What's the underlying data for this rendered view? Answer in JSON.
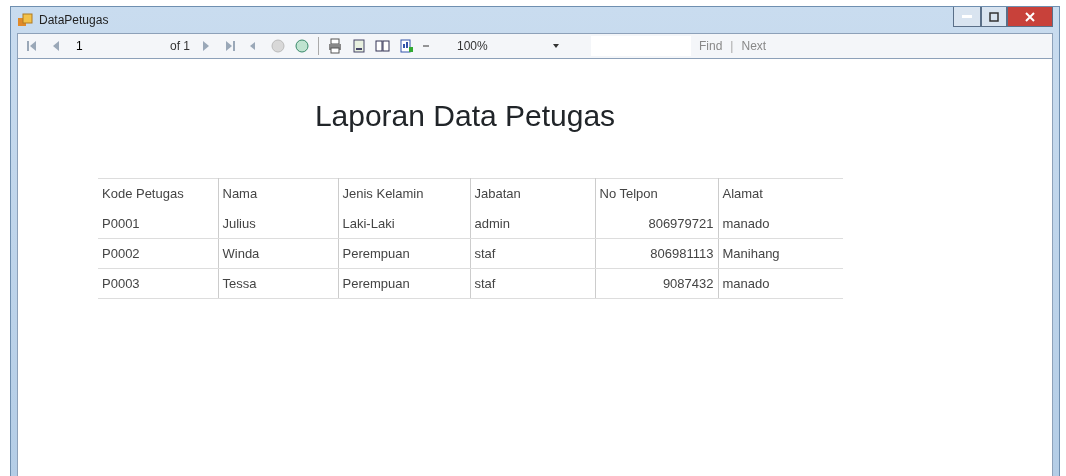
{
  "window": {
    "title": "DataPetugas"
  },
  "toolbar": {
    "page": "1",
    "page_count": "of 1",
    "zoom": "100%",
    "find_label": "Find",
    "separator": "|",
    "next_label": "Next"
  },
  "report": {
    "title": "Laporan Data Petugas",
    "table": {
      "columns": [
        "Kode Petugas",
        "Nama",
        "Jenis Kelamin",
        "Jabatan",
        "No Telpon",
        "Alamat"
      ],
      "rows": [
        [
          "P0001",
          "Julius",
          "Laki-Laki",
          "admin",
          "806979721",
          "manado"
        ],
        [
          "P0002",
          "Winda",
          "Perempuan",
          "staf",
          "806981113",
          "Manihang"
        ],
        [
          "P0003",
          "Tessa",
          "Perempuan",
          "staf",
          "9087432",
          "manado"
        ]
      ]
    }
  }
}
